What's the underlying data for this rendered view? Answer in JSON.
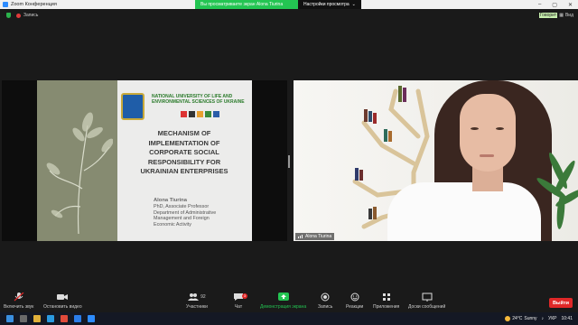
{
  "window": {
    "title": "Zoom Конференция"
  },
  "viewbar": {
    "viewing_text": "Вы просматриваете экран Alona Tiurina",
    "view_options": "Настройки просмотра"
  },
  "topstrip": {
    "recording": "Запись",
    "speaker_tag": "Говорит",
    "view_label": "Вид"
  },
  "slide": {
    "university": "NATIONAL UNIVERSITY OF LIFE AND ENVIRONMENTAL SCIENCES OF UKRAINE",
    "title_lines": [
      "MECHANISM OF",
      "IMPLEMENTATION OF",
      "CORPORATE SOCIAL",
      "RESPONSIBILITY FOR",
      "UKRAINIAN ENTERPRISES"
    ],
    "author_name": "Alona Tiurina",
    "author_lines": [
      "PhD, Associate Professor",
      "Department of Administrative",
      "Management and Foreign",
      "Economic Activity"
    ],
    "colors": {
      "left_panel": "#868b71",
      "university_text": "#2a7a2a"
    }
  },
  "video": {
    "participant_name": "Alona Tiurina"
  },
  "toolbar": {
    "audio": "Включить звук",
    "video": "Остановить видео",
    "participants": "Участники",
    "participants_count": "92",
    "chat": "Чат",
    "chat_badge": "3",
    "share": "Демонстрация экрана",
    "record": "Запись",
    "reactions": "Реакции",
    "apps": "Приложения",
    "whiteboards": "Доски сообщений",
    "end": "Выйти",
    "colors": {
      "share": "#23c552",
      "end": "#e02828"
    }
  },
  "taskbar": {
    "weather_temp": "24°C",
    "weather_text": "Sunny",
    "language": "УКР",
    "time": "10:41"
  }
}
